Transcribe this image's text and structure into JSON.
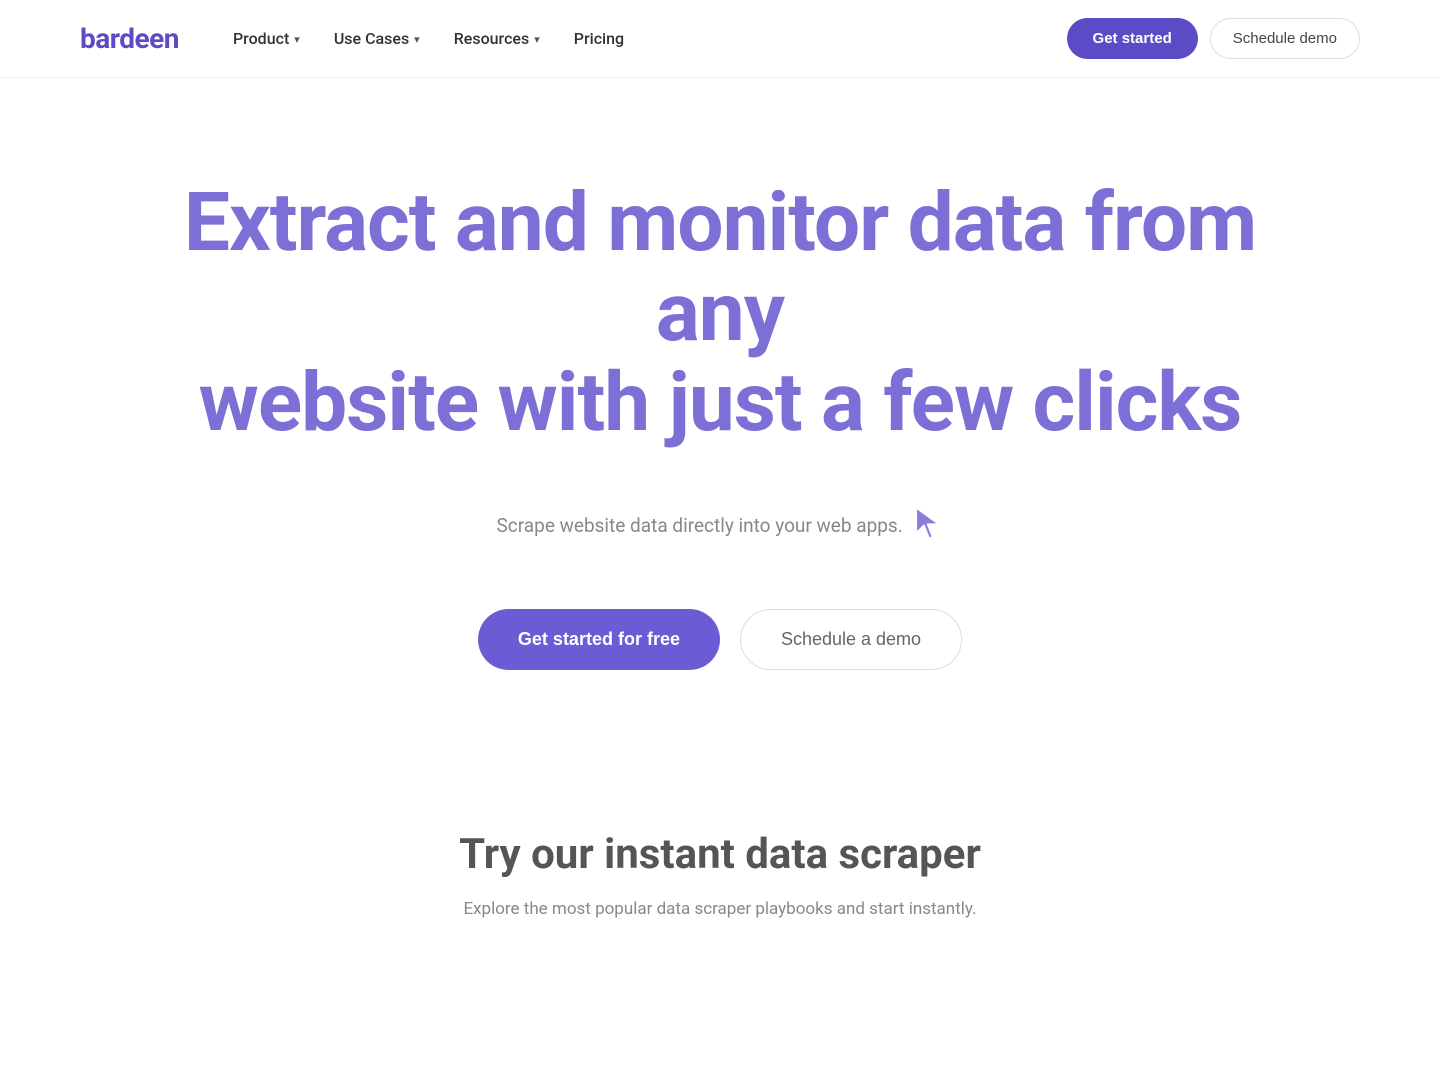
{
  "brand": {
    "logo_text": "bardeen",
    "logo_color": "#5c4bc7"
  },
  "nav": {
    "links": [
      {
        "label": "Product",
        "has_dropdown": true
      },
      {
        "label": "Use Cases",
        "has_dropdown": true
      },
      {
        "label": "Resources",
        "has_dropdown": true
      },
      {
        "label": "Pricing",
        "has_dropdown": false
      }
    ],
    "cta_primary": "Get started",
    "cta_secondary": "Schedule demo"
  },
  "hero": {
    "title_line1": "Extract and monitor data from any",
    "title_line2": "website with just a few clicks",
    "subtitle": "Scrape website data directly into your web apps.",
    "btn_primary": "Get started for free",
    "btn_secondary": "Schedule a demo"
  },
  "section": {
    "title": "Try our instant data scraper",
    "subtitle": "Explore the most popular data scraper playbooks and start instantly."
  }
}
